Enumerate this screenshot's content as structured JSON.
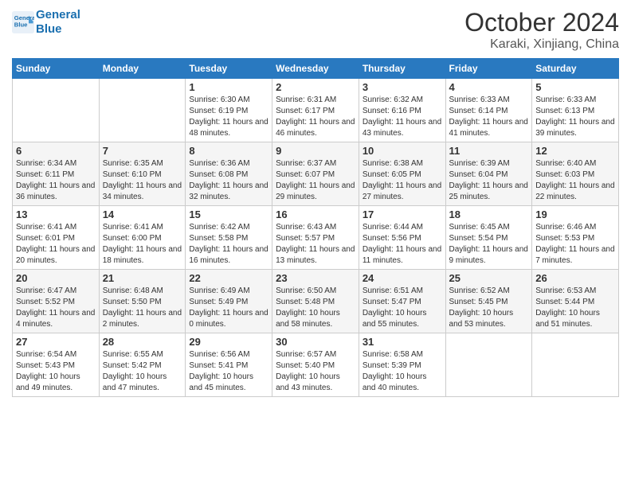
{
  "header": {
    "logo_line1": "General",
    "logo_line2": "Blue",
    "month": "October 2024",
    "location": "Karaki, Xinjiang, China"
  },
  "weekdays": [
    "Sunday",
    "Monday",
    "Tuesday",
    "Wednesday",
    "Thursday",
    "Friday",
    "Saturday"
  ],
  "weeks": [
    [
      {
        "day": "",
        "info": ""
      },
      {
        "day": "",
        "info": ""
      },
      {
        "day": "1",
        "info": "Sunrise: 6:30 AM\nSunset: 6:19 PM\nDaylight: 11 hours and 48 minutes."
      },
      {
        "day": "2",
        "info": "Sunrise: 6:31 AM\nSunset: 6:17 PM\nDaylight: 11 hours and 46 minutes."
      },
      {
        "day": "3",
        "info": "Sunrise: 6:32 AM\nSunset: 6:16 PM\nDaylight: 11 hours and 43 minutes."
      },
      {
        "day": "4",
        "info": "Sunrise: 6:33 AM\nSunset: 6:14 PM\nDaylight: 11 hours and 41 minutes."
      },
      {
        "day": "5",
        "info": "Sunrise: 6:33 AM\nSunset: 6:13 PM\nDaylight: 11 hours and 39 minutes."
      }
    ],
    [
      {
        "day": "6",
        "info": "Sunrise: 6:34 AM\nSunset: 6:11 PM\nDaylight: 11 hours and 36 minutes."
      },
      {
        "day": "7",
        "info": "Sunrise: 6:35 AM\nSunset: 6:10 PM\nDaylight: 11 hours and 34 minutes."
      },
      {
        "day": "8",
        "info": "Sunrise: 6:36 AM\nSunset: 6:08 PM\nDaylight: 11 hours and 32 minutes."
      },
      {
        "day": "9",
        "info": "Sunrise: 6:37 AM\nSunset: 6:07 PM\nDaylight: 11 hours and 29 minutes."
      },
      {
        "day": "10",
        "info": "Sunrise: 6:38 AM\nSunset: 6:05 PM\nDaylight: 11 hours and 27 minutes."
      },
      {
        "day": "11",
        "info": "Sunrise: 6:39 AM\nSunset: 6:04 PM\nDaylight: 11 hours and 25 minutes."
      },
      {
        "day": "12",
        "info": "Sunrise: 6:40 AM\nSunset: 6:03 PM\nDaylight: 11 hours and 22 minutes."
      }
    ],
    [
      {
        "day": "13",
        "info": "Sunrise: 6:41 AM\nSunset: 6:01 PM\nDaylight: 11 hours and 20 minutes."
      },
      {
        "day": "14",
        "info": "Sunrise: 6:41 AM\nSunset: 6:00 PM\nDaylight: 11 hours and 18 minutes."
      },
      {
        "day": "15",
        "info": "Sunrise: 6:42 AM\nSunset: 5:58 PM\nDaylight: 11 hours and 16 minutes."
      },
      {
        "day": "16",
        "info": "Sunrise: 6:43 AM\nSunset: 5:57 PM\nDaylight: 11 hours and 13 minutes."
      },
      {
        "day": "17",
        "info": "Sunrise: 6:44 AM\nSunset: 5:56 PM\nDaylight: 11 hours and 11 minutes."
      },
      {
        "day": "18",
        "info": "Sunrise: 6:45 AM\nSunset: 5:54 PM\nDaylight: 11 hours and 9 minutes."
      },
      {
        "day": "19",
        "info": "Sunrise: 6:46 AM\nSunset: 5:53 PM\nDaylight: 11 hours and 7 minutes."
      }
    ],
    [
      {
        "day": "20",
        "info": "Sunrise: 6:47 AM\nSunset: 5:52 PM\nDaylight: 11 hours and 4 minutes."
      },
      {
        "day": "21",
        "info": "Sunrise: 6:48 AM\nSunset: 5:50 PM\nDaylight: 11 hours and 2 minutes."
      },
      {
        "day": "22",
        "info": "Sunrise: 6:49 AM\nSunset: 5:49 PM\nDaylight: 11 hours and 0 minutes."
      },
      {
        "day": "23",
        "info": "Sunrise: 6:50 AM\nSunset: 5:48 PM\nDaylight: 10 hours and 58 minutes."
      },
      {
        "day": "24",
        "info": "Sunrise: 6:51 AM\nSunset: 5:47 PM\nDaylight: 10 hours and 55 minutes."
      },
      {
        "day": "25",
        "info": "Sunrise: 6:52 AM\nSunset: 5:45 PM\nDaylight: 10 hours and 53 minutes."
      },
      {
        "day": "26",
        "info": "Sunrise: 6:53 AM\nSunset: 5:44 PM\nDaylight: 10 hours and 51 minutes."
      }
    ],
    [
      {
        "day": "27",
        "info": "Sunrise: 6:54 AM\nSunset: 5:43 PM\nDaylight: 10 hours and 49 minutes."
      },
      {
        "day": "28",
        "info": "Sunrise: 6:55 AM\nSunset: 5:42 PM\nDaylight: 10 hours and 47 minutes."
      },
      {
        "day": "29",
        "info": "Sunrise: 6:56 AM\nSunset: 5:41 PM\nDaylight: 10 hours and 45 minutes."
      },
      {
        "day": "30",
        "info": "Sunrise: 6:57 AM\nSunset: 5:40 PM\nDaylight: 10 hours and 43 minutes."
      },
      {
        "day": "31",
        "info": "Sunrise: 6:58 AM\nSunset: 5:39 PM\nDaylight: 10 hours and 40 minutes."
      },
      {
        "day": "",
        "info": ""
      },
      {
        "day": "",
        "info": ""
      }
    ]
  ],
  "colors": {
    "header_bg": "#2979c0",
    "accent": "#1a6faf"
  }
}
